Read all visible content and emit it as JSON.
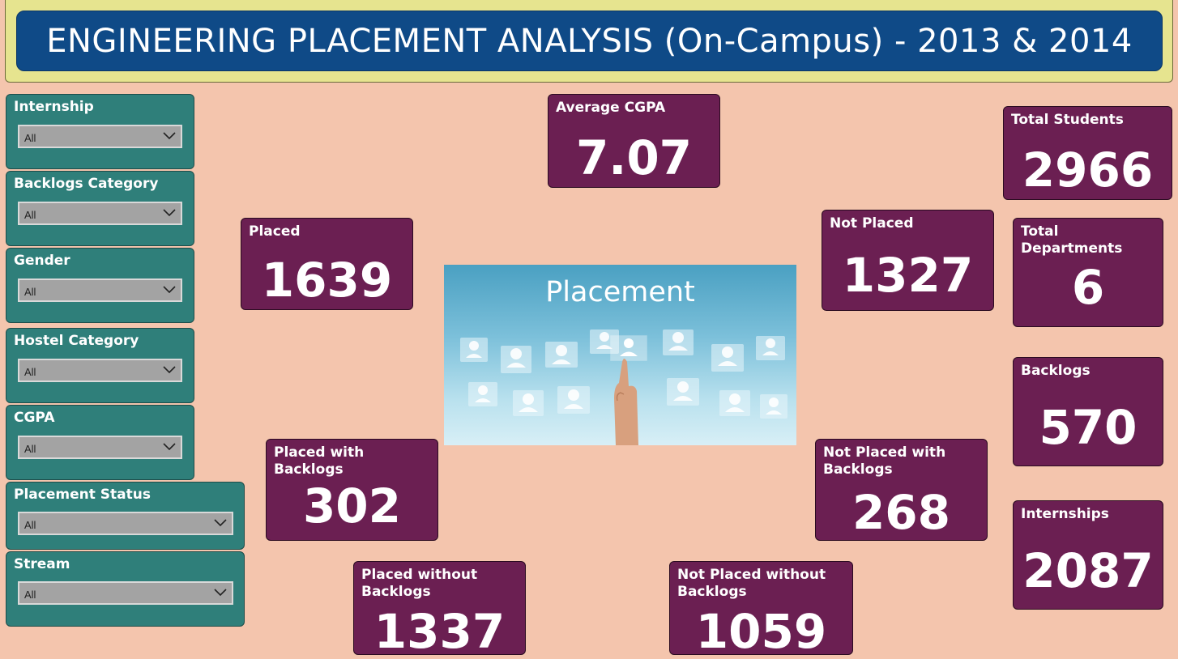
{
  "header": {
    "title": "ENGINEERING PLACEMENT ANALYSIS (On-Campus) - 2013 & 2014"
  },
  "filters": [
    {
      "label": "Internship",
      "value": "All"
    },
    {
      "label": "Backlogs Category",
      "value": "All"
    },
    {
      "label": "Gender",
      "value": "All"
    },
    {
      "label": "Hostel Category",
      "value": "All"
    },
    {
      "label": "CGPA",
      "value": "All"
    },
    {
      "label": "Placement Status",
      "value": "All"
    },
    {
      "label": "Stream",
      "value": "All"
    }
  ],
  "kpis": {
    "average_cgpa": {
      "label": "Average CGPA",
      "value": "7.07"
    },
    "total_students": {
      "label": "Total Students",
      "value": "2966"
    },
    "placed": {
      "label": "Placed",
      "value": "1639"
    },
    "not_placed": {
      "label": "Not Placed",
      "value": "1327"
    },
    "total_departments": {
      "label": "Total Departments",
      "value": "6"
    },
    "backlogs": {
      "label": "Backlogs",
      "value": "570"
    },
    "placed_with_backlogs": {
      "label": "Placed with Backlogs",
      "value": "302"
    },
    "not_placed_with_backlogs": {
      "label": "Not Placed with Backlogs",
      "value": "268"
    },
    "internships": {
      "label": "Internships",
      "value": "2087"
    },
    "placed_without_backlogs": {
      "label": "Placed without Backlogs",
      "value": "1337"
    },
    "not_placed_without_backlogs": {
      "label": "Not Placed without Backlogs",
      "value": "1059"
    }
  },
  "image": {
    "caption": "Placement"
  },
  "colors": {
    "background": "#f4c5ad",
    "header_band": "#e6e48f",
    "title_bar": "#0f4a87",
    "slicer": "#2f7f7a",
    "card": "#6b1f52"
  }
}
